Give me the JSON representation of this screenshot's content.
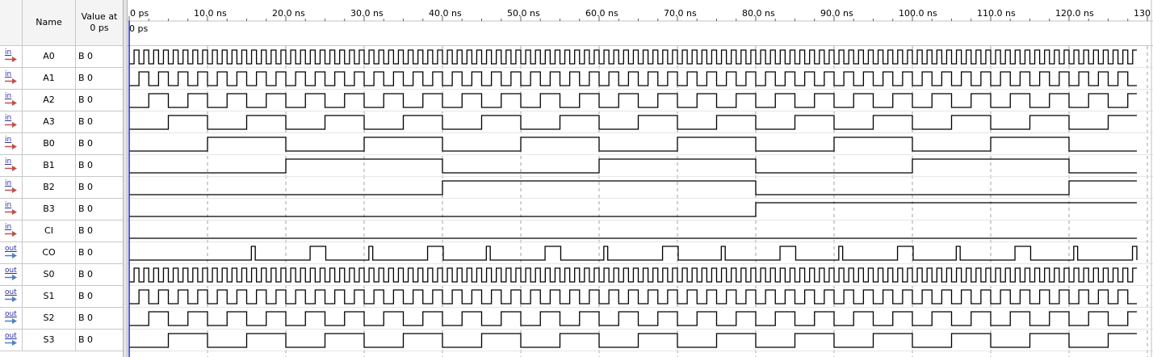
{
  "header": {
    "name_col": "Name",
    "value_col_line1": "Value at",
    "value_col_line2": "0 ps"
  },
  "cursor_label": "0 ps",
  "timeline": {
    "unit": "ns",
    "ticks": [
      "0 ps",
      "10.0 ns",
      "20.0 ns",
      "30.0 ns",
      "40.0 ns",
      "50.0 ns",
      "60.0 ns",
      "70.0 ns",
      "80.0 ns",
      "90.0 ns",
      "100.0 ns",
      "110.0 ns",
      "120.0 ns",
      "130"
    ],
    "visible_range_ns": [
      0,
      130
    ]
  },
  "colors": {
    "waveform": "#000000",
    "cursor": "#1c2fd0",
    "grid": "#a0a0a0",
    "input_pin": "#c0504d",
    "output_pin": "#4f81bd"
  },
  "signals": [
    {
      "type": "in",
      "pin_label": "in",
      "name": "A0",
      "value": "B 0",
      "period_ns": 1.25,
      "start_low": true
    },
    {
      "type": "in",
      "pin_label": "in",
      "name": "A1",
      "value": "B 0",
      "period_ns": 2.5,
      "start_low": true
    },
    {
      "type": "in",
      "pin_label": "in",
      "name": "A2",
      "value": "B 0",
      "period_ns": 5,
      "start_low": true
    },
    {
      "type": "in",
      "pin_label": "in",
      "name": "A3",
      "value": "B 0",
      "period_ns": 10,
      "start_low": true
    },
    {
      "type": "in",
      "pin_label": "in",
      "name": "B0",
      "value": "B 0",
      "period_ns": 20,
      "start_low": true
    },
    {
      "type": "in",
      "pin_label": "in",
      "name": "B1",
      "value": "B 0",
      "period_ns": 40,
      "start_low": true
    },
    {
      "type": "in",
      "pin_label": "in",
      "name": "B2",
      "value": "B 0",
      "period_ns": 80,
      "start_low": true
    },
    {
      "type": "in",
      "pin_label": "in",
      "name": "B3",
      "value": "B 0",
      "period_ns": 160,
      "start_low": true
    },
    {
      "type": "in",
      "pin_label": "in",
      "name": "CI",
      "value": "B 0",
      "period_ns": 320,
      "start_low": true
    },
    {
      "type": "out",
      "pin_label": "out",
      "name": "CO",
      "value": "B 0",
      "period_ns": 10,
      "pattern": "pulse"
    },
    {
      "type": "out",
      "pin_label": "out",
      "name": "S0",
      "value": "B 0",
      "period_ns": 1.25,
      "start_low": true
    },
    {
      "type": "out",
      "pin_label": "out",
      "name": "S1",
      "value": "B 0",
      "period_ns": 2.5,
      "start_low": true
    },
    {
      "type": "out",
      "pin_label": "out",
      "name": "S2",
      "value": "B 0",
      "period_ns": 5,
      "start_low": true
    },
    {
      "type": "out",
      "pin_label": "out",
      "name": "S3",
      "value": "B 0",
      "period_ns": 10,
      "start_low": true
    }
  ]
}
